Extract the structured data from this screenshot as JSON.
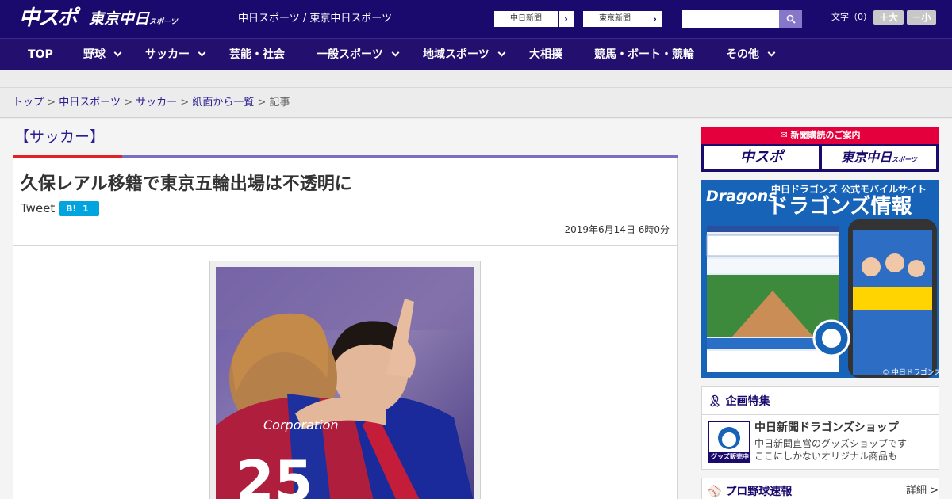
{
  "header": {
    "logo_chuspo": "中スポ",
    "logo_tokyo": "東京中日",
    "logo_tokyo_sub": "スポーツ",
    "site_names": "中日スポーツ / 東京中日スポーツ",
    "ext_links": [
      {
        "label": "中日新聞"
      },
      {
        "label": "東京新聞"
      }
    ],
    "search": {
      "value": "",
      "placeholder": ""
    },
    "font_label": "文字（0）",
    "font_larger": "＋大",
    "font_smaller": "－小"
  },
  "nav": {
    "items": [
      {
        "label": "TOP",
        "dropdown": false
      },
      {
        "label": "野球",
        "dropdown": true
      },
      {
        "label": "サッカー",
        "dropdown": true
      },
      {
        "label": "芸能・社会",
        "dropdown": false
      },
      {
        "label": "一般スポーツ",
        "dropdown": true
      },
      {
        "label": "地域スポーツ",
        "dropdown": true
      },
      {
        "label": "大相撲",
        "dropdown": false
      },
      {
        "label": "競馬・ボート・競輪",
        "dropdown": false
      },
      {
        "label": "その他",
        "dropdown": true
      }
    ]
  },
  "breadcrumb": {
    "items": [
      "トップ",
      "中日スポーツ",
      "サッカー",
      "紙面から一覧"
    ],
    "current": "記事",
    "separator": ">"
  },
  "article": {
    "section": "【サッカー】",
    "headline": "久保レアル移籍で東京五輪出場は不透明に",
    "tweet_label": "Tweet",
    "hatena_label": "B!",
    "hatena_count": "1",
    "date": "2019年6月14日 6時0分"
  },
  "sidebar": {
    "subscription": {
      "banner_title": "新聞購読のご案内",
      "logo_chuspo": "中スポ",
      "logo_tokyo": "東京中日",
      "logo_tokyo_sub": "スポーツ"
    },
    "dragons_ad": {
      "brand": "Dragons",
      "title_small": "中日ドラゴンズ 公式モバイルサイト",
      "title_large": "ドラゴンズ情報",
      "copyright": "© 中日ドラゴンズ"
    },
    "features": {
      "heading": "企画特集",
      "shop_title": "中日新聞ドラゴンズショップ",
      "shop_line1": "中日新聞直営のグッズショップです",
      "shop_line2": "ここにしかないオリジナル商品も",
      "shop_thumb_text": "グッズ販売中"
    },
    "baseball": {
      "heading": "プロ野球速報",
      "more": "詳細 >"
    }
  },
  "colors": {
    "header_bg": "#1a0a6e",
    "nav_bg": "#23106e",
    "accent_red": "#e02424",
    "link": "#2a1d8f",
    "hatena": "#00a4de",
    "ad_blue": "#1663b8"
  }
}
